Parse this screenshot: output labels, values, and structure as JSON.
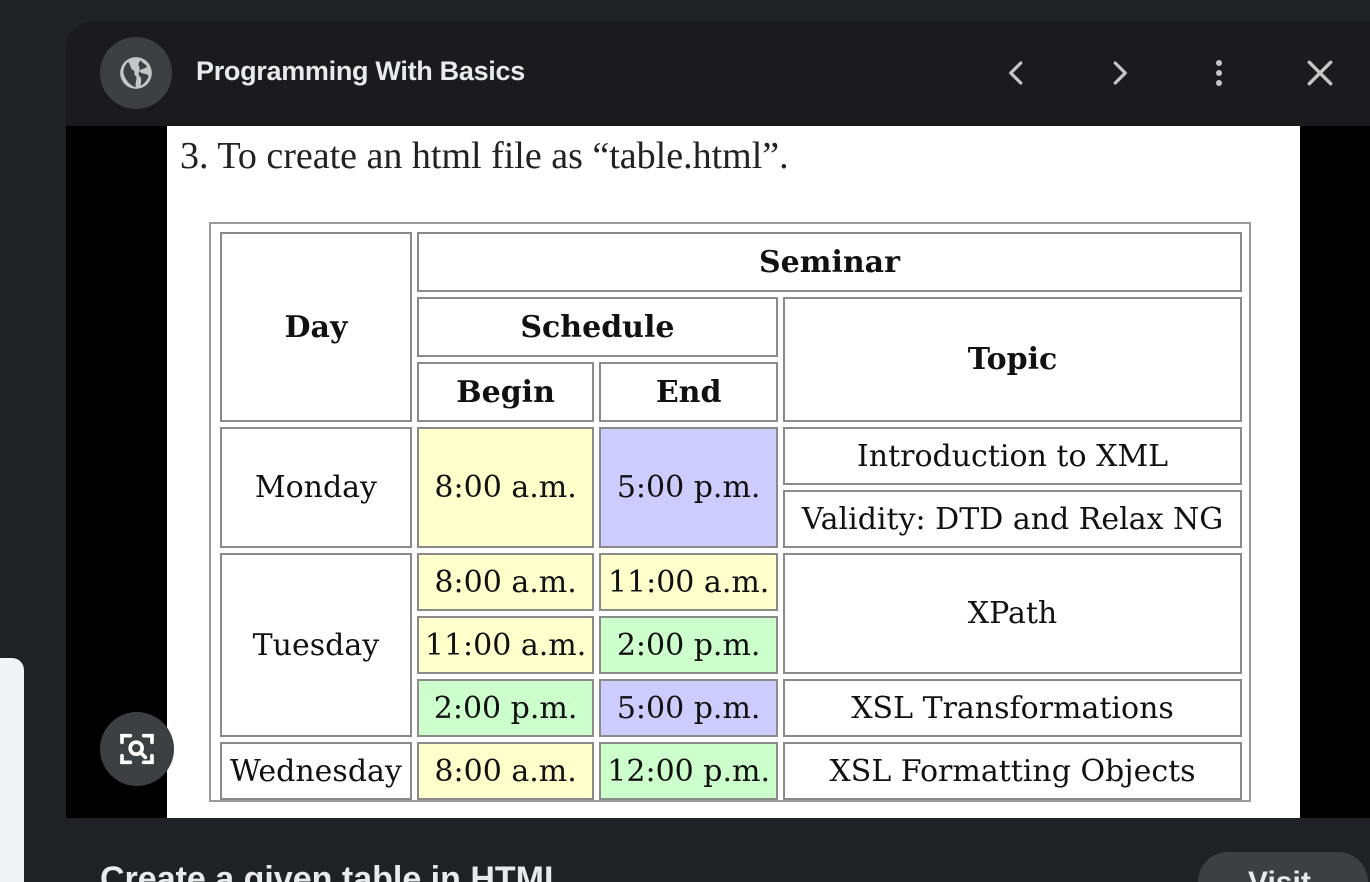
{
  "header": {
    "site_title": "Programming With Basics"
  },
  "page": {
    "caption": "3. To create an html file as “table.html”."
  },
  "table": {
    "h_day": "Day",
    "h_seminar": "Seminar",
    "h_schedule": "Schedule",
    "h_topic": "Topic",
    "h_begin": "Begin",
    "h_end": "End",
    "monday": {
      "day": "Monday",
      "begin": "8:00 a.m.",
      "end": "5:00 p.m.",
      "topic1": "Introduction to XML",
      "topic2": "Validity: DTD and Relax NG"
    },
    "tuesday": {
      "day": "Tuesday",
      "r1_begin": "8:00 a.m.",
      "r1_end": "11:00 a.m.",
      "r2_begin": "11:00 a.m.",
      "r2_end": "2:00 p.m.",
      "r3_begin": "2:00 p.m.",
      "r3_end": "5:00 p.m.",
      "topic1": "XPath",
      "topic2": "XSL Transformations"
    },
    "wednesday": {
      "day": "Wednesday",
      "begin": "8:00 a.m.",
      "end": "12:00 p.m.",
      "topic": "XSL Formatting Objects"
    },
    "colors": {
      "yellow": "#ffffcc",
      "blue": "#ccccff",
      "green": "#ccffcc"
    }
  },
  "footer": {
    "title": "Create a given table in HTML",
    "visit_label": "Visit"
  },
  "icons": {
    "site": "globe-icon",
    "prev": "chevron-left-icon",
    "next": "chevron-right-icon",
    "more": "more-vert-icon",
    "close": "close-icon",
    "lens": "lens-search-icon"
  }
}
